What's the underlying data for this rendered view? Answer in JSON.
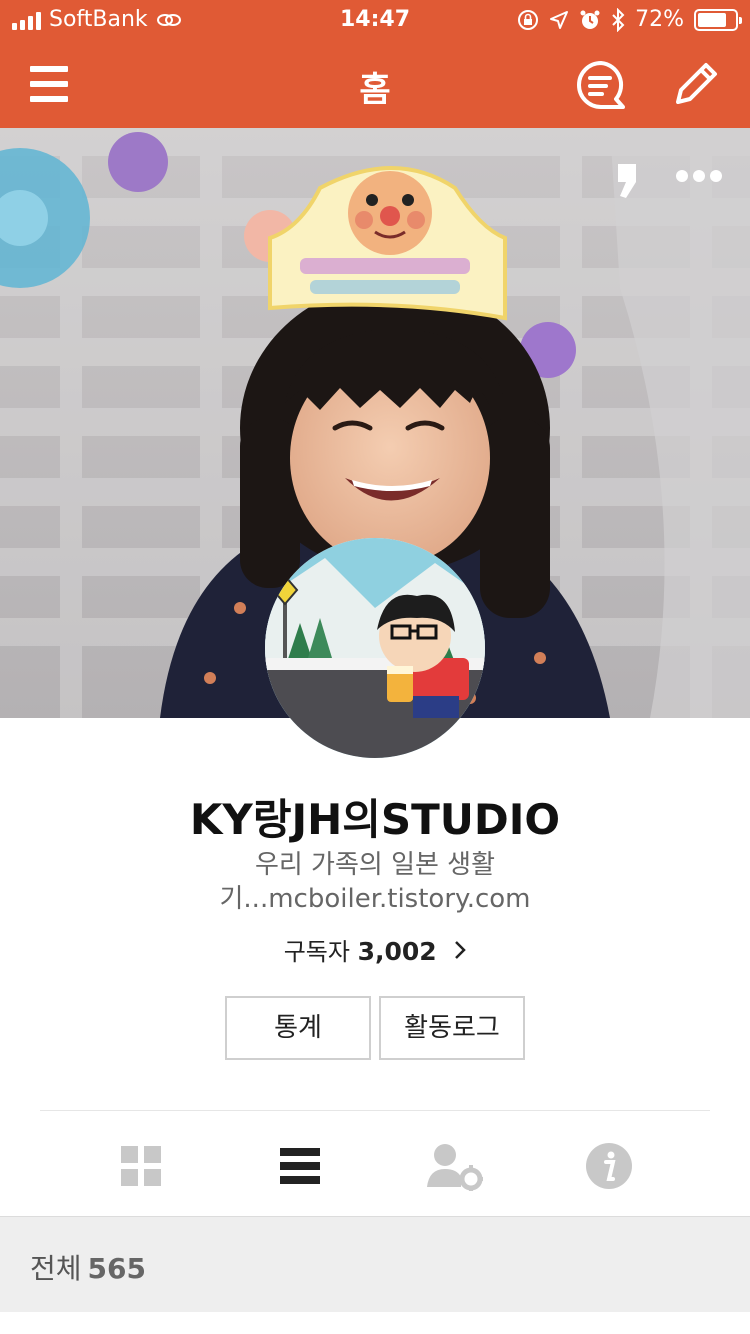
{
  "status_bar": {
    "carrier": "SoftBank",
    "time": "14:47",
    "battery": "72%",
    "battery_level": 0.72
  },
  "nav": {
    "title": "홈",
    "menu_icon": "hamburger-icon",
    "compose_icon": "pencil-icon",
    "list_icon": "message-list-icon"
  },
  "cover": {
    "quote_icon": "comma-quote-icon",
    "more_icon": "more-dots-icon"
  },
  "profile": {
    "name": "KY랑JH의STUDIO",
    "description": "우리 가족의 일본 생활",
    "url_line": "기...mcboiler.tistory.com",
    "subscribers_label": "구독자",
    "subscribers_count": "3,002"
  },
  "buttons": {
    "stats": "통계",
    "activity_log": "활동로그"
  },
  "tabs": {
    "grid": "grid-icon",
    "list": "list-icon",
    "user_settings": "user-settings-icon",
    "info": "info-icon"
  },
  "section": {
    "label": "전체",
    "count": "565"
  },
  "colors": {
    "brand": "#e05a35",
    "tab_inactive": "#c8c8c8",
    "tab_active": "#222222"
  }
}
